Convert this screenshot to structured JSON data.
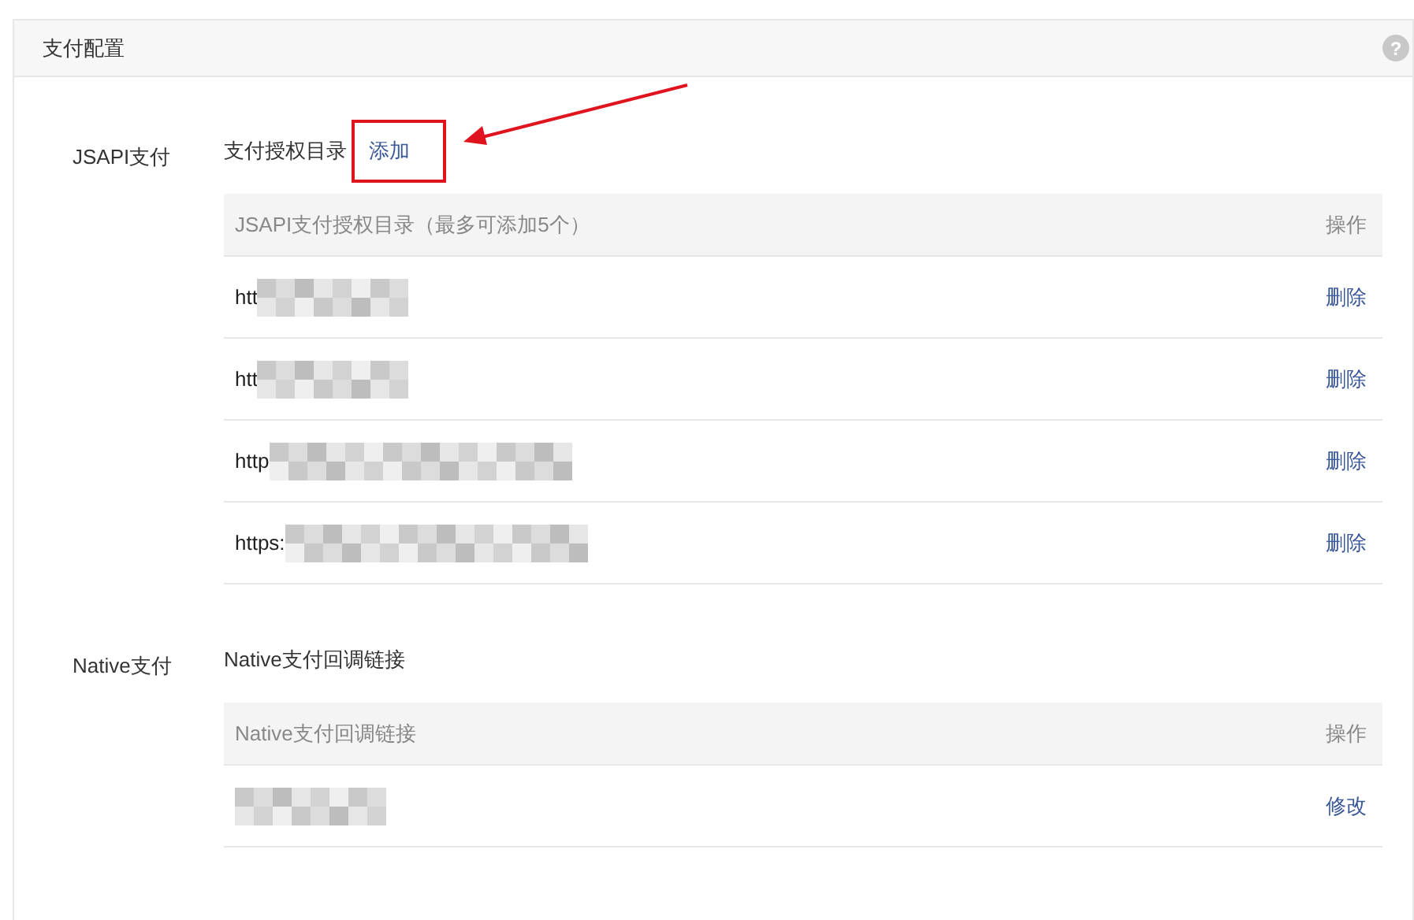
{
  "panel": {
    "title": "支付配置",
    "help_icon": "?"
  },
  "sections": [
    {
      "label": "JSAPI支付",
      "subtitle": "支付授权目录",
      "action": "添加",
      "highlighted": true,
      "table": {
        "columns": [
          "JSAPI支付授权目录（最多可添加5个）",
          "操作"
        ],
        "rows": [
          {
            "url": "htt",
            "action": "删除"
          },
          {
            "url": "htt",
            "action": "删除"
          },
          {
            "url": "http",
            "action": "删除"
          },
          {
            "url": "https:",
            "action": "删除"
          }
        ]
      }
    },
    {
      "label": "Native支付",
      "subtitle": "Native支付回调链接",
      "table": {
        "columns": [
          "Native支付回调链接",
          "操作"
        ],
        "rows": [
          {
            "action": "修改"
          }
        ]
      }
    }
  ]
}
